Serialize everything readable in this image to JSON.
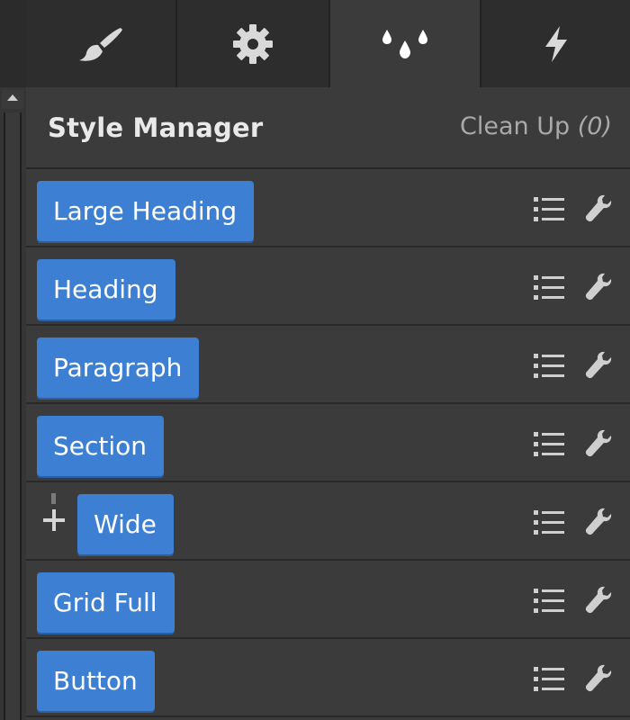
{
  "tabs": [
    {
      "name": "style",
      "icon": "brush-icon"
    },
    {
      "name": "settings",
      "icon": "gear-icon"
    },
    {
      "name": "style-manager",
      "icon": "drops-icon",
      "active": true
    },
    {
      "name": "interactions",
      "icon": "lightning-icon"
    }
  ],
  "header": {
    "title": "Style Manager",
    "cleanup_label": "Clean Up",
    "cleanup_count": "(0)"
  },
  "styles": [
    {
      "label": "Large Heading"
    },
    {
      "label": "Heading"
    },
    {
      "label": "Paragraph"
    },
    {
      "label": "Section"
    },
    {
      "label": "Wide",
      "combo": true
    },
    {
      "label": "Grid Full"
    },
    {
      "label": "Button"
    }
  ],
  "icons": {
    "list": "list-icon",
    "wrench": "wrench-icon"
  },
  "colors": {
    "accent": "#3d7fd3",
    "panel": "#3b3b3b",
    "tab_inactive": "#2d2d2d"
  }
}
